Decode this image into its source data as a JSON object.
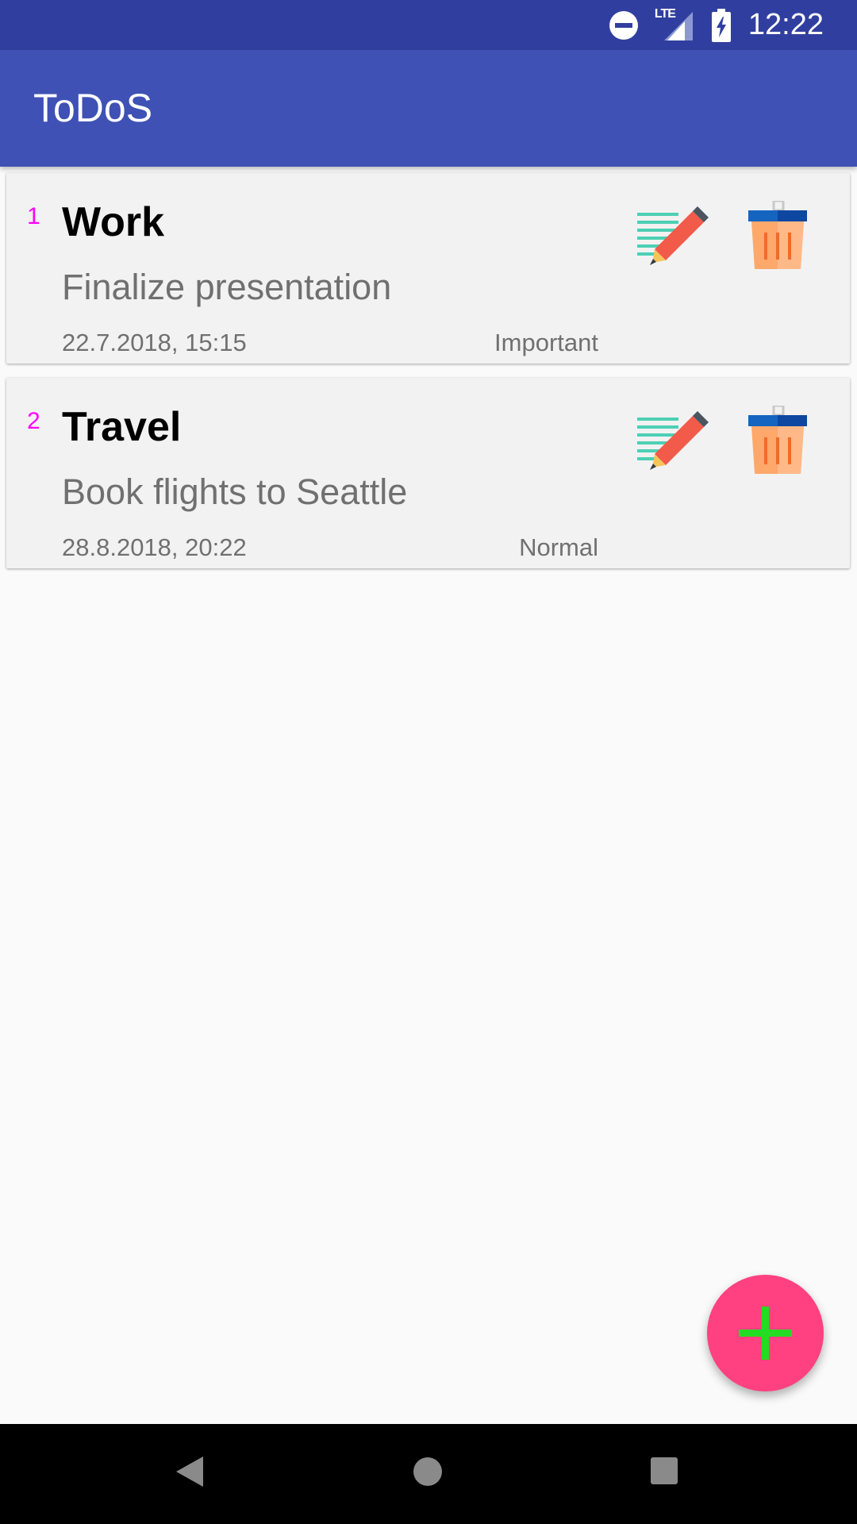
{
  "status_bar": {
    "lte_label": "LTE",
    "time": "12:22"
  },
  "app_bar": {
    "title": "ToDoS"
  },
  "todos": [
    {
      "index": "1",
      "title": "Work",
      "description": "Finalize presentation",
      "datetime": "22.7.2018, 15:15",
      "priority": "Important"
    },
    {
      "index": "2",
      "title": "Travel",
      "description": "Book flights to Seattle",
      "datetime": "28.8.2018, 20:22",
      "priority": "Normal"
    }
  ],
  "icons": {
    "status": [
      "do-not-disturb-icon",
      "lte-signal-icon",
      "battery-charging-icon"
    ],
    "card": [
      "edit-note-icon",
      "trash-bin-icon"
    ],
    "fab": "plus-icon",
    "nav": [
      "back-icon",
      "home-icon",
      "recents-icon"
    ]
  },
  "colors": {
    "status_bar": "#303f9f",
    "app_bar": "#3f51b5",
    "fab": "#ff4081",
    "fab_plus": "#22dd22",
    "index_number": "#ff00ff"
  }
}
